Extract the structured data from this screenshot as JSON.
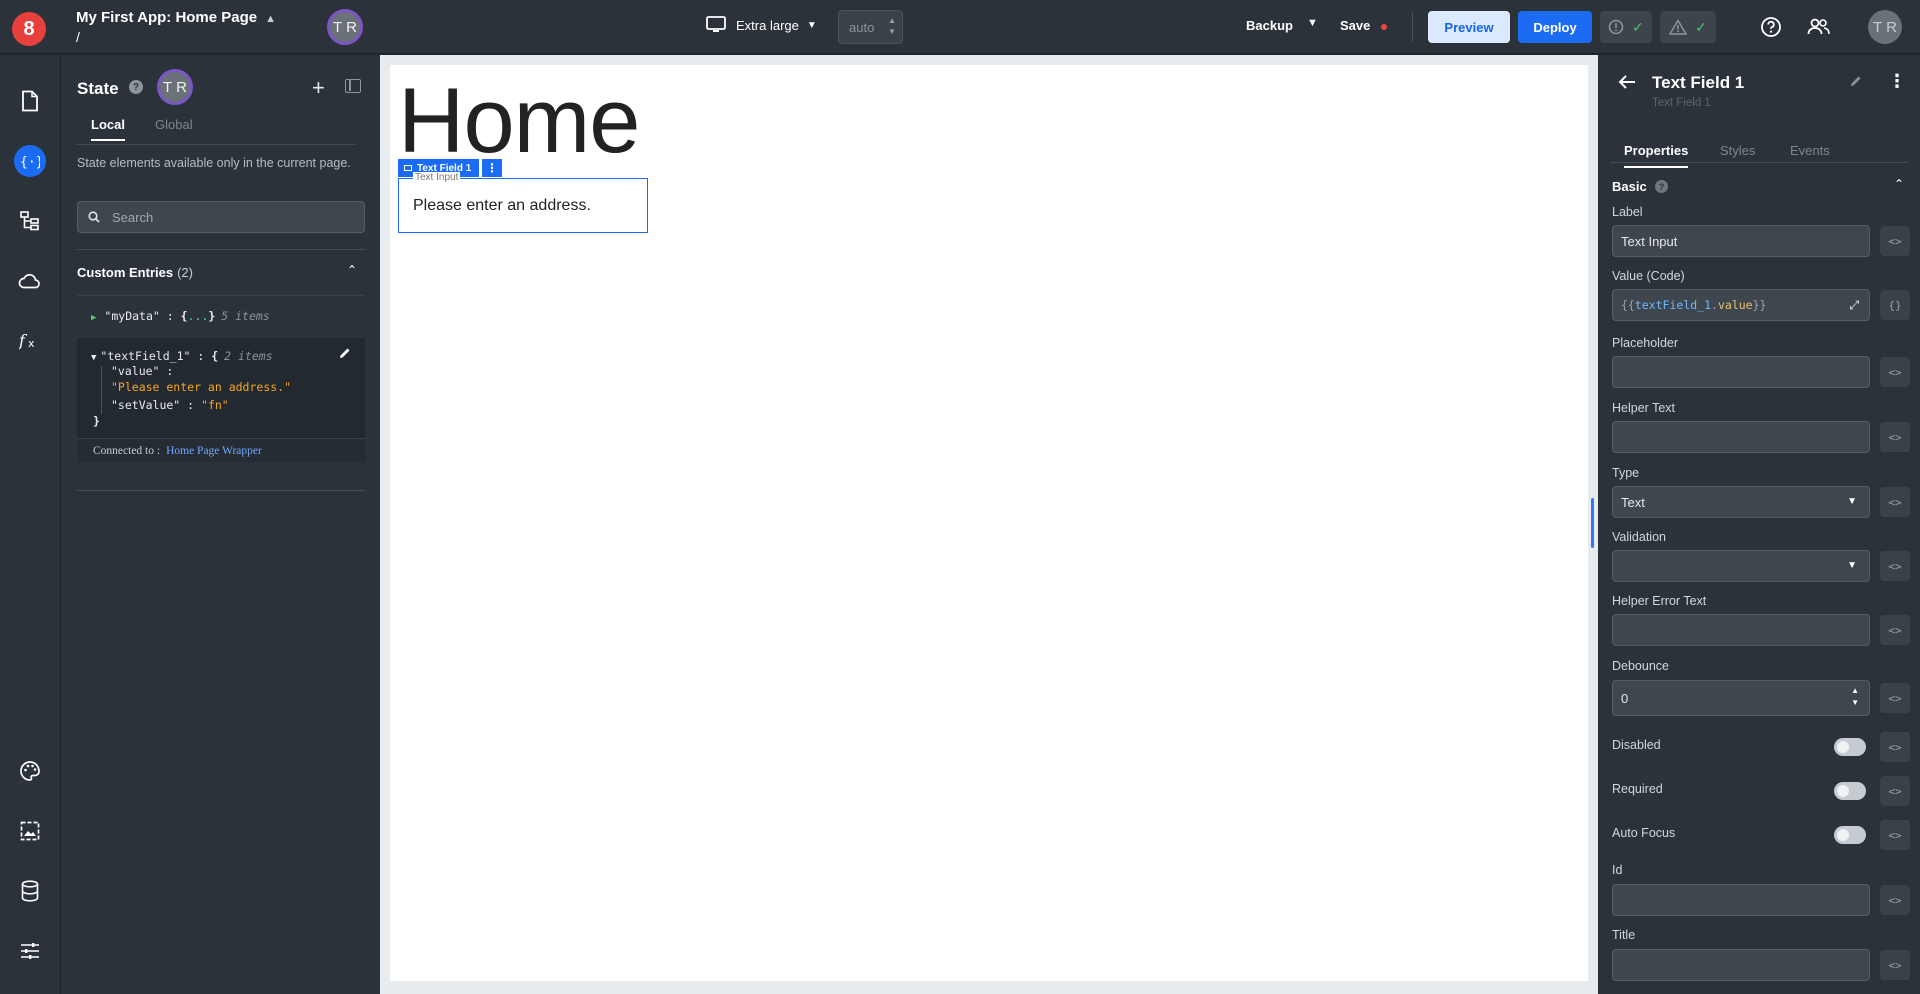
{
  "topbar": {
    "logo": "8",
    "app_title": "My First App: Home Page",
    "path": "/",
    "user_initials": "T R",
    "device_label": "Extra large",
    "width_value": "auto",
    "backup_label": "Backup",
    "save_label": "Save",
    "preview_label": "Preview",
    "deploy_label": "Deploy",
    "accent": "#1b6cf2"
  },
  "state_panel": {
    "title": "State",
    "user_initials": "T R",
    "tabs": [
      "Local",
      "Global"
    ],
    "description": "State elements available only in the current page.",
    "search_placeholder": "Search",
    "custom_entries_title": "Custom Entries",
    "custom_entries_count": "(2)",
    "entry1": {
      "key": "\"myData\"",
      "sep": " : ",
      "open": "{",
      "dots": "...",
      "close": "}",
      "meta": "5 items"
    },
    "entry2": {
      "key": "\"textField_1\"",
      "sep": " : ",
      "open": "{",
      "meta": "2 items",
      "value_key": "\"value\" :",
      "value_str": "\"Please enter an address.\"",
      "setvalue_key": "\"setValue\" : ",
      "setvalue_val": "\"fn\"",
      "close": "}"
    },
    "connected_label": "Connected to :",
    "connected_link": "Home Page Wrapper"
  },
  "canvas": {
    "heading": "Home",
    "tag_label": "Text Field 1",
    "field_label": "Text Input",
    "field_value": "Please enter an address."
  },
  "properties": {
    "title": "Text Field 1",
    "subtitle": "Text Field 1",
    "tabs": [
      "Properties",
      "Styles",
      "Events"
    ],
    "section": "Basic",
    "label_label": "Label",
    "label_value": "Text Input",
    "value_label": "Value (Code)",
    "value_code": {
      "open": "{{ ",
      "id": "textField_1",
      "dot": ".",
      "prop": "value",
      "close": " }}"
    },
    "placeholder_label": "Placeholder",
    "helper_text_label": "Helper Text",
    "type_label": "Type",
    "type_value": "Text",
    "validation_label": "Validation",
    "helper_error_label": "Helper Error Text",
    "debounce_label": "Debounce",
    "debounce_value": "0",
    "disabled_label": "Disabled",
    "required_label": "Required",
    "autofocus_label": "Auto Focus",
    "id_label": "Id",
    "title_label": "Title",
    "code_btn": "<>"
  }
}
